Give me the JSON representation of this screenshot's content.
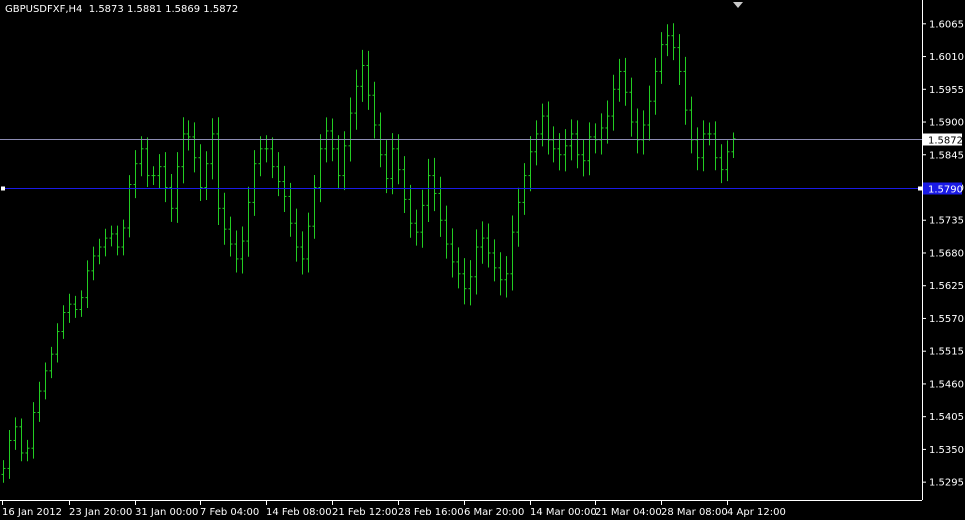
{
  "header": {
    "symbol_timeframe": "GBPUSDFXF,H4",
    "ohlc": "1.5873 1.5881 1.5869 1.5872"
  },
  "colors": {
    "background": "#000000",
    "bars": "#22cc22",
    "axis_text": "#ffffff",
    "axis_lines": "#ffffff",
    "bid_line": "#8c8cb4",
    "hline": "#1a1ae6",
    "bid_label_bg": "#ffffff",
    "bid_label_text": "#000000",
    "hline_label_bg": "#1a1ae6"
  },
  "chart_data": {
    "type": "ohlc",
    "title": "GBPUSDFXF,H4",
    "ylim": [
      1.5265,
      1.6105
    ],
    "grid": false,
    "y_ticks": [
      "1.6065",
      "1.6010",
      "1.5955",
      "1.5900",
      "1.5845",
      "1.5790",
      "1.5735",
      "1.5680",
      "1.5625",
      "1.5570",
      "1.5515",
      "1.5460",
      "1.5405",
      "1.5350",
      "1.5295"
    ],
    "x_tick_labels": [
      "16 Jan 2012",
      "23 Jan 20:00",
      "31 Jan 00:00",
      "7 Feb 04:00",
      "14 Feb 08:00",
      "21 Feb 12:00",
      "28 Feb 16:00",
      "6 Mar 20:00",
      "14 Mar 00:00",
      "21 Mar 04:00",
      "28 Mar 08:00",
      "4 Apr 12:00"
    ],
    "current_price": {
      "label": "1.5872",
      "value": 1.5872
    },
    "horizontal_line": {
      "label": "1.5790",
      "value": 1.579
    },
    "closes": [
      1.5318,
      1.5365,
      1.5388,
      1.5344,
      1.5352,
      1.5412,
      1.5448,
      1.5482,
      1.551,
      1.5548,
      1.558,
      1.5594,
      1.5585,
      1.5605,
      1.565,
      1.5675,
      1.569,
      1.5705,
      1.5712,
      1.569,
      1.5722,
      1.5795,
      1.583,
      1.5855,
      1.581,
      1.581,
      1.5825,
      1.579,
      1.5755,
      1.5825,
      1.588,
      1.5875,
      1.584,
      1.579,
      1.583,
      1.588,
      1.5755,
      1.572,
      1.5695,
      1.567,
      1.57,
      1.5765,
      1.583,
      1.5855,
      1.5855,
      1.5825,
      1.58,
      1.5775,
      1.573,
      1.569,
      1.567,
      1.5725,
      1.579,
      1.5855,
      1.5885,
      1.5855,
      1.581,
      1.586,
      1.5915,
      1.596,
      1.5995,
      1.5945,
      1.5895,
      1.5845,
      1.5805,
      1.5855,
      1.582,
      1.577,
      1.573,
      1.5715,
      1.576,
      1.581,
      1.578,
      1.5735,
      1.5695,
      1.5665,
      1.5645,
      1.562,
      1.564,
      1.569,
      1.5705,
      1.568,
      1.5655,
      1.5635,
      1.5645,
      1.5715,
      1.5765,
      1.581,
      1.585,
      1.588,
      1.591,
      1.587,
      1.5855,
      1.5845,
      1.586,
      1.588,
      1.5845,
      1.5835,
      1.5875,
      1.587,
      1.589,
      1.591,
      1.5955,
      1.5985,
      1.595,
      1.59,
      1.587,
      1.5895,
      1.5935,
      1.5985,
      1.603,
      1.6045,
      1.6025,
      1.5985,
      1.592,
      1.587,
      1.584,
      1.588,
      1.588,
      1.584,
      1.582,
      1.585,
      1.5872
    ],
    "ranges": [
      0.004,
      0.005,
      0.0045,
      0.004,
      0.004,
      0.005,
      0.0045,
      0.004,
      0.0035,
      0.004,
      0.0035,
      0.005,
      0.004,
      0.0035,
      0.005,
      0.0045,
      0.004,
      0.0045,
      0.004,
      0.004,
      0.004,
      0.0045,
      0.0065,
      0.006,
      0.0055,
      0.0045,
      0.006,
      0.007,
      0.0065,
      0.007,
      0.008,
      0.0065,
      0.007,
      0.0065,
      0.006,
      0.0075,
      0.008,
      0.0075,
      0.006,
      0.0065,
      0.007,
      0.0075,
      0.0065,
      0.006,
      0.0065,
      0.0055,
      0.007,
      0.0075,
      0.0065,
      0.007,
      0.0075,
      0.0065,
      0.006,
      0.007,
      0.0065,
      0.006,
      0.0065,
      0.007,
      0.0075,
      0.008,
      0.0075,
      0.007,
      0.0065,
      0.006,
      0.007,
      0.0075,
      0.007,
      0.0065,
      0.007,
      0.0065,
      0.0075,
      0.008,
      0.0085,
      0.008,
      0.007,
      0.0075,
      0.007,
      0.0075,
      0.008,
      0.0085,
      0.008,
      0.007,
      0.0065,
      0.0075,
      0.0085,
      0.008,
      0.007,
      0.006,
      0.0075,
      0.0065,
      0.006,
      0.007,
      0.0065,
      0.0075,
      0.008,
      0.007,
      0.0065,
      0.0075,
      0.007,
      0.0065,
      0.007,
      0.0075,
      0.007,
      0.006,
      0.0065,
      0.007,
      0.0065,
      0.007,
      0.0075,
      0.0065,
      0.006,
      0.0055,
      0.006,
      0.0065,
      0.007,
      0.0065,
      0.006,
      0.0065,
      0.0055,
      0.006,
      0.0065,
      0.0055,
      0.003
    ]
  }
}
